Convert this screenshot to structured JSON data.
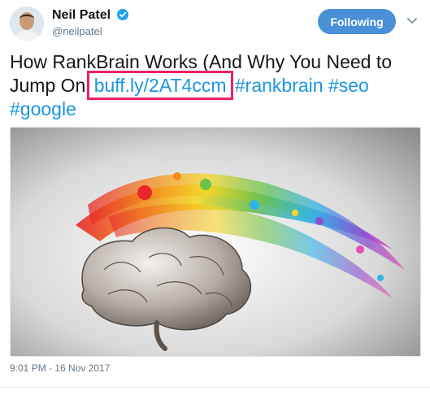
{
  "author": {
    "name": "Neil Patel",
    "handle": "@neilpatel",
    "avatar_icon": "avatar-photo",
    "verified_icon": "verified-badge-icon"
  },
  "actions": {
    "follow_label": "Following",
    "more_icon": "chevron-down-icon"
  },
  "tweet": {
    "text_before": "How RankBrain Works (And Why You Need to Jump On ",
    "link": "buff.ly/2AT4ccm",
    "hashtags": [
      "#rankbrain",
      "#seo",
      "#google"
    ]
  },
  "media": {
    "description_icon": "brain-paint-splash-image"
  },
  "meta": {
    "timestamp": "9:01 PM - 16 Nov 2017"
  },
  "colors": {
    "link": "#1b95e0",
    "follow_button": "#4a90d6",
    "highlight": "#ef1f6a",
    "verified": "#1da1f2"
  }
}
